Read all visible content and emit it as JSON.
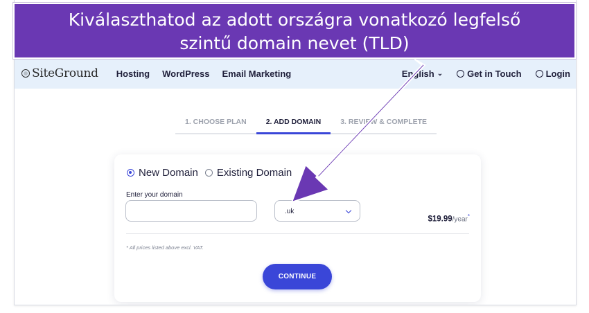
{
  "annotation": {
    "line1": "Kiválaszthatod az adott országra vonatkozó legfelső",
    "line2": "szintű domain nevet (TLD)",
    "color": "#6a38b3"
  },
  "nav": {
    "logo": "SiteGround",
    "links": [
      "Hosting",
      "WordPress",
      "Email Marketing"
    ],
    "language": "English",
    "get_in_touch": "Get in Touch",
    "login": "Login"
  },
  "steps": [
    {
      "label": "1. CHOOSE PLAN",
      "active": false
    },
    {
      "label": "2. ADD DOMAIN",
      "active": true
    },
    {
      "label": "3. REVIEW & COMPLETE",
      "active": false
    }
  ],
  "form": {
    "option_new": "New Domain",
    "option_existing": "Existing Domain",
    "selected_option": "New Domain",
    "domain_label": "Enter your domain",
    "domain_value": "",
    "tld_value": ".uk",
    "price": "$19.99",
    "price_unit": "/year",
    "price_mark": "*",
    "vat_note": "* All prices listed above excl. VAT.",
    "continue_label": "CONTINUE"
  },
  "colors": {
    "accent": "#3a46d8",
    "nav_bg": "#e6f0fb"
  }
}
